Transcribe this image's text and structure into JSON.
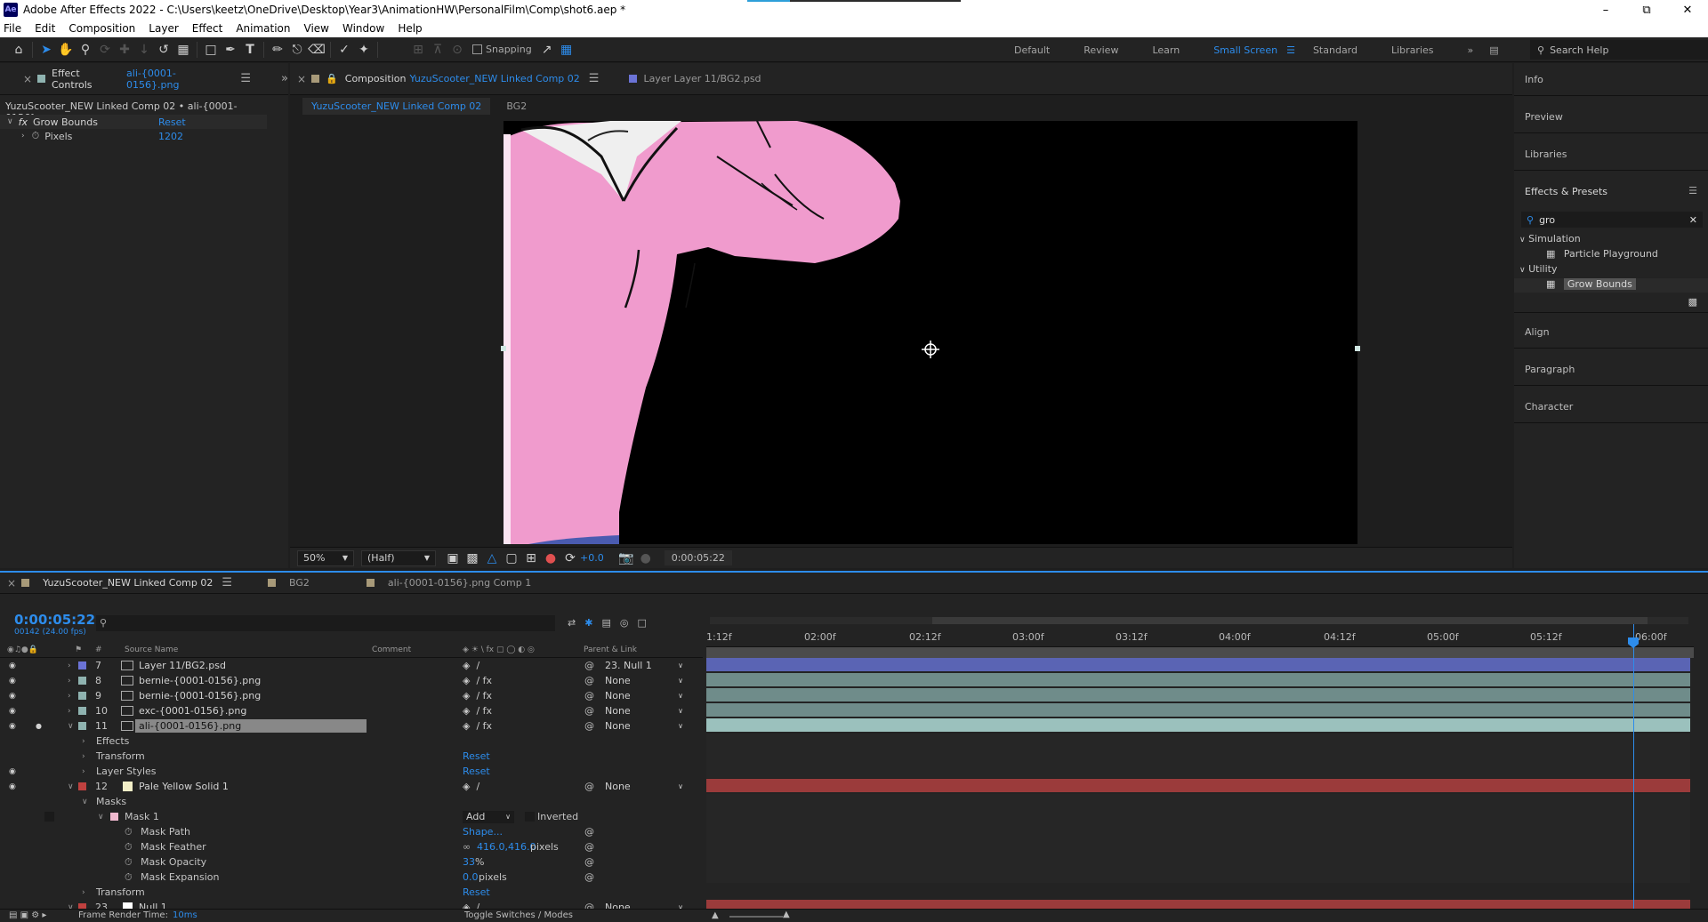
{
  "window": {
    "title": "Adobe After Effects 2022 - C:\\Users\\keetz\\OneDrive\\Desktop\\Year3\\AnimationHW\\PersonalFilm\\Comp\\shot6.aep *",
    "logo": "Ae",
    "controls": [
      "minimize-icon",
      "restore-icon",
      "close-icon"
    ]
  },
  "menu": [
    "File",
    "Edit",
    "Composition",
    "Layer",
    "Effect",
    "Animation",
    "View",
    "Window",
    "Help"
  ],
  "toolbar": {
    "snapping_label": "Snapping",
    "workspaces": [
      "Default",
      "Review",
      "Learn",
      "Small Screen",
      "Standard",
      "Libraries"
    ],
    "active_workspace": "Small Screen",
    "search_help": "Search Help"
  },
  "effect_controls": {
    "tab_prefix": "Effect Controls",
    "tab_layer": "ali-{0001-0156}.png",
    "subtitle": "YuzuScooter_NEW Linked Comp 02 • ali-{0001-0156}.png",
    "effect_name": "Grow Bounds",
    "reset_label": "Reset",
    "param_name": "Pixels",
    "param_value": "1202"
  },
  "composition": {
    "tab_prefix": "Composition",
    "tab_comp": "YuzuScooter_NEW Linked Comp 02",
    "layer_tab": "Layer  Layer 11/BG2.psd",
    "crumbs": [
      "YuzuScooter_NEW Linked Comp 02",
      "BG2"
    ],
    "zoom": "50%",
    "resolution": "(Half)",
    "exposure": "+0.0",
    "timecode": "0:00:05:22"
  },
  "right_panel": {
    "items": [
      "Info",
      "Preview",
      "Libraries",
      "Effects & Presets"
    ],
    "search_value": "gro",
    "categories": [
      {
        "name": "Simulation",
        "effects": [
          "Particle Playground"
        ]
      },
      {
        "name": "Utility",
        "effects": [
          "Grow Bounds"
        ]
      }
    ],
    "lower_items": [
      "Align",
      "Paragraph",
      "Character"
    ]
  },
  "timeline": {
    "tabs": [
      "YuzuScooter_NEW Linked Comp 02",
      "BG2",
      "ali-{0001-0156}.png Comp 1"
    ],
    "timecode": "0:00:05:22",
    "fps_line": "00142 (24.00 fps)",
    "headers": {
      "number": "#",
      "source_name": "Source Name",
      "comment": "Comment",
      "parent": "Parent & Link"
    },
    "ruler_ticks": [
      "1:12f",
      "02:00f",
      "02:12f",
      "03:00f",
      "03:12f",
      "04:00f",
      "04:12f",
      "05:00f",
      "05:12f",
      "06:00f"
    ],
    "layers": [
      {
        "num": "7",
        "name": "Layer 11/BG2.psd",
        "parent": "23. Null 1",
        "color": "#6b73d6",
        "bar": "#5a64b4"
      },
      {
        "num": "8",
        "name": "bernie-{0001-0156}.png",
        "parent": "None",
        "color": "#8fb3b0",
        "bar": "#6f8c8a"
      },
      {
        "num": "9",
        "name": "bernie-{0001-0156}.png",
        "parent": "None",
        "color": "#8fb3b0",
        "bar": "#6f8c8a"
      },
      {
        "num": "10",
        "name": "exc-{0001-0156}.png",
        "parent": "None",
        "color": "#8fb3b0",
        "bar": "#6f8c8a"
      },
      {
        "num": "11",
        "name": "ali-{0001-0156}.png",
        "parent": "None",
        "color": "#8fb3b0",
        "bar": "#9bc1bd"
      }
    ],
    "layer11_props": [
      "Effects",
      "Transform",
      "Layer Styles"
    ],
    "layer12": {
      "num": "12",
      "name": "Pale Yellow Solid 1",
      "parent": "None",
      "color": "#c0413f",
      "bar": "#9b3b3b"
    },
    "masks_label": "Masks",
    "mask1": {
      "name": "Mask 1",
      "mode": "Add",
      "inverted_label": "Inverted"
    },
    "mask_props": [
      {
        "name": "Mask Path",
        "value": "Shape...",
        "unit": ""
      },
      {
        "name": "Mask Feather",
        "value": "416.0,416.0",
        "unit": "pixels"
      },
      {
        "name": "Mask Opacity",
        "value": "33",
        "unit": "%"
      },
      {
        "name": "Mask Expansion",
        "value": "0.0",
        "unit": "pixels"
      }
    ],
    "transform_label": "Transform",
    "layer23": {
      "num": "23",
      "name": "Null 1",
      "parent": "None"
    }
  },
  "status": {
    "render_label": "Frame Render Time:",
    "render_value": "10ms",
    "toggle_label": "Toggle Switches / Modes"
  }
}
